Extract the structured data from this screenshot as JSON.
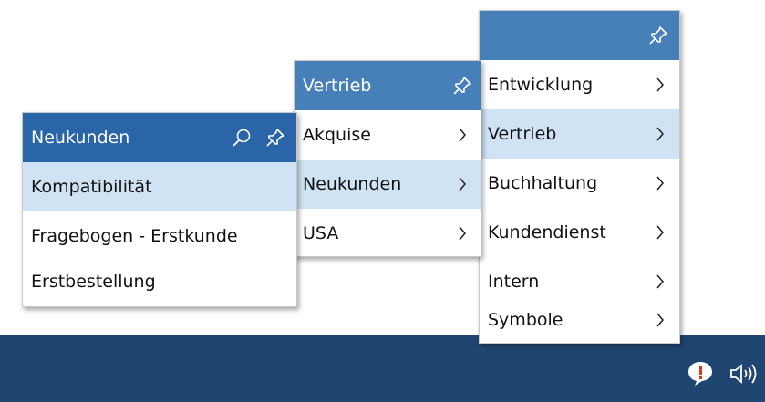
{
  "colors": {
    "taskbar": "#1f4670",
    "header_light": "#4780b8",
    "header_dark": "#2a65a8",
    "highlight": "#d0e3f4"
  },
  "menu_main": {
    "header_title": "",
    "items": [
      {
        "label": "Entwicklung"
      },
      {
        "label": "Vertrieb"
      },
      {
        "label": "Buchhaltung"
      },
      {
        "label": "Kundendienst"
      },
      {
        "label": "Intern"
      },
      {
        "label": "Symbole"
      }
    ]
  },
  "menu_vertrieb": {
    "header_title": "Vertrieb",
    "items": [
      {
        "label": "Akquise"
      },
      {
        "label": "Neukunden"
      },
      {
        "label": "USA"
      }
    ]
  },
  "menu_neukunden": {
    "header_title": "Neukunden",
    "items": [
      {
        "label": "Kompatibilität"
      },
      {
        "label": "Fragebogen - Erstkunde"
      },
      {
        "label": "Erstbestellung"
      }
    ]
  },
  "icons": [
    "pin-icon",
    "search-icon",
    "chevron-right-icon",
    "notification-icon",
    "speaker-icon"
  ]
}
